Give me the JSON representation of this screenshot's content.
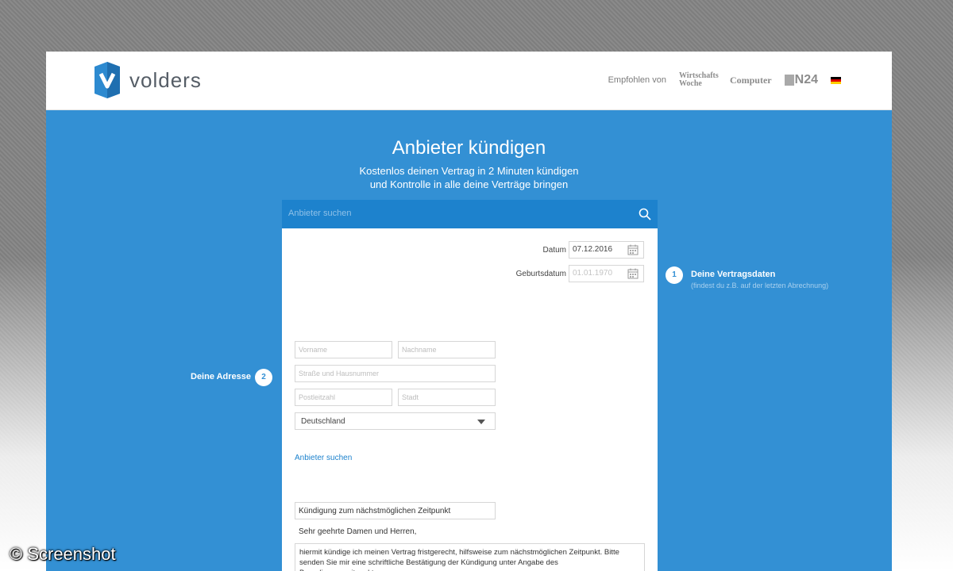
{
  "header": {
    "brand": "volders",
    "recommended_label": "Empfohlen von",
    "press": {
      "wiwo": "Wirtschafts Woche",
      "computer": "Computer",
      "n24": "N24"
    },
    "flag_colors": [
      "#000000",
      "#dd0000",
      "#ffce00"
    ]
  },
  "hero": {
    "title": "Anbieter kündigen",
    "subtitle_line1": "Kostenlos deinen Vertrag in 2 Minuten kündigen",
    "subtitle_line2": "und Kontrolle in alle deine Verträge bringen"
  },
  "search": {
    "placeholder": "Anbieter suchen",
    "icon": "search-icon"
  },
  "contract": {
    "date_label": "Datum",
    "date_value": "07.12.2016",
    "birthdate_label": "Geburtsdatum",
    "birthdate_placeholder": "01.01.1970"
  },
  "steps": [
    {
      "number": "1",
      "title": "Deine Vertragsdaten",
      "hint": "(findest du z.B. auf der letzten Abrechnung)"
    },
    {
      "number": "2",
      "title": "Deine Adresse"
    }
  ],
  "address": {
    "firstname_placeholder": "Vorname",
    "lastname_placeholder": "Nachname",
    "street_placeholder": "Straße und Hausnummer",
    "zip_placeholder": "Postleitzahl",
    "city_placeholder": "Stadt",
    "country_value": "Deutschland"
  },
  "provider_link": "Anbieter suchen",
  "letter": {
    "subject": "Kündigung zum nächstmöglichen Zeitpunkt",
    "salutation": "Sehr geehrte Damen und Herren,",
    "body": "hiermit kündige ich meinen Vertrag fristgerecht, hilfsweise zum nächstmöglichen Zeitpunkt. Bitte senden Sie mir eine schriftliche Bestätigung der Kündigung unter Angabe des Beendigungszeitpunktes zu."
  },
  "watermark": "© Screenshot",
  "colors": {
    "hero_blue": "#3390d4",
    "search_blue": "#1d82cd"
  }
}
